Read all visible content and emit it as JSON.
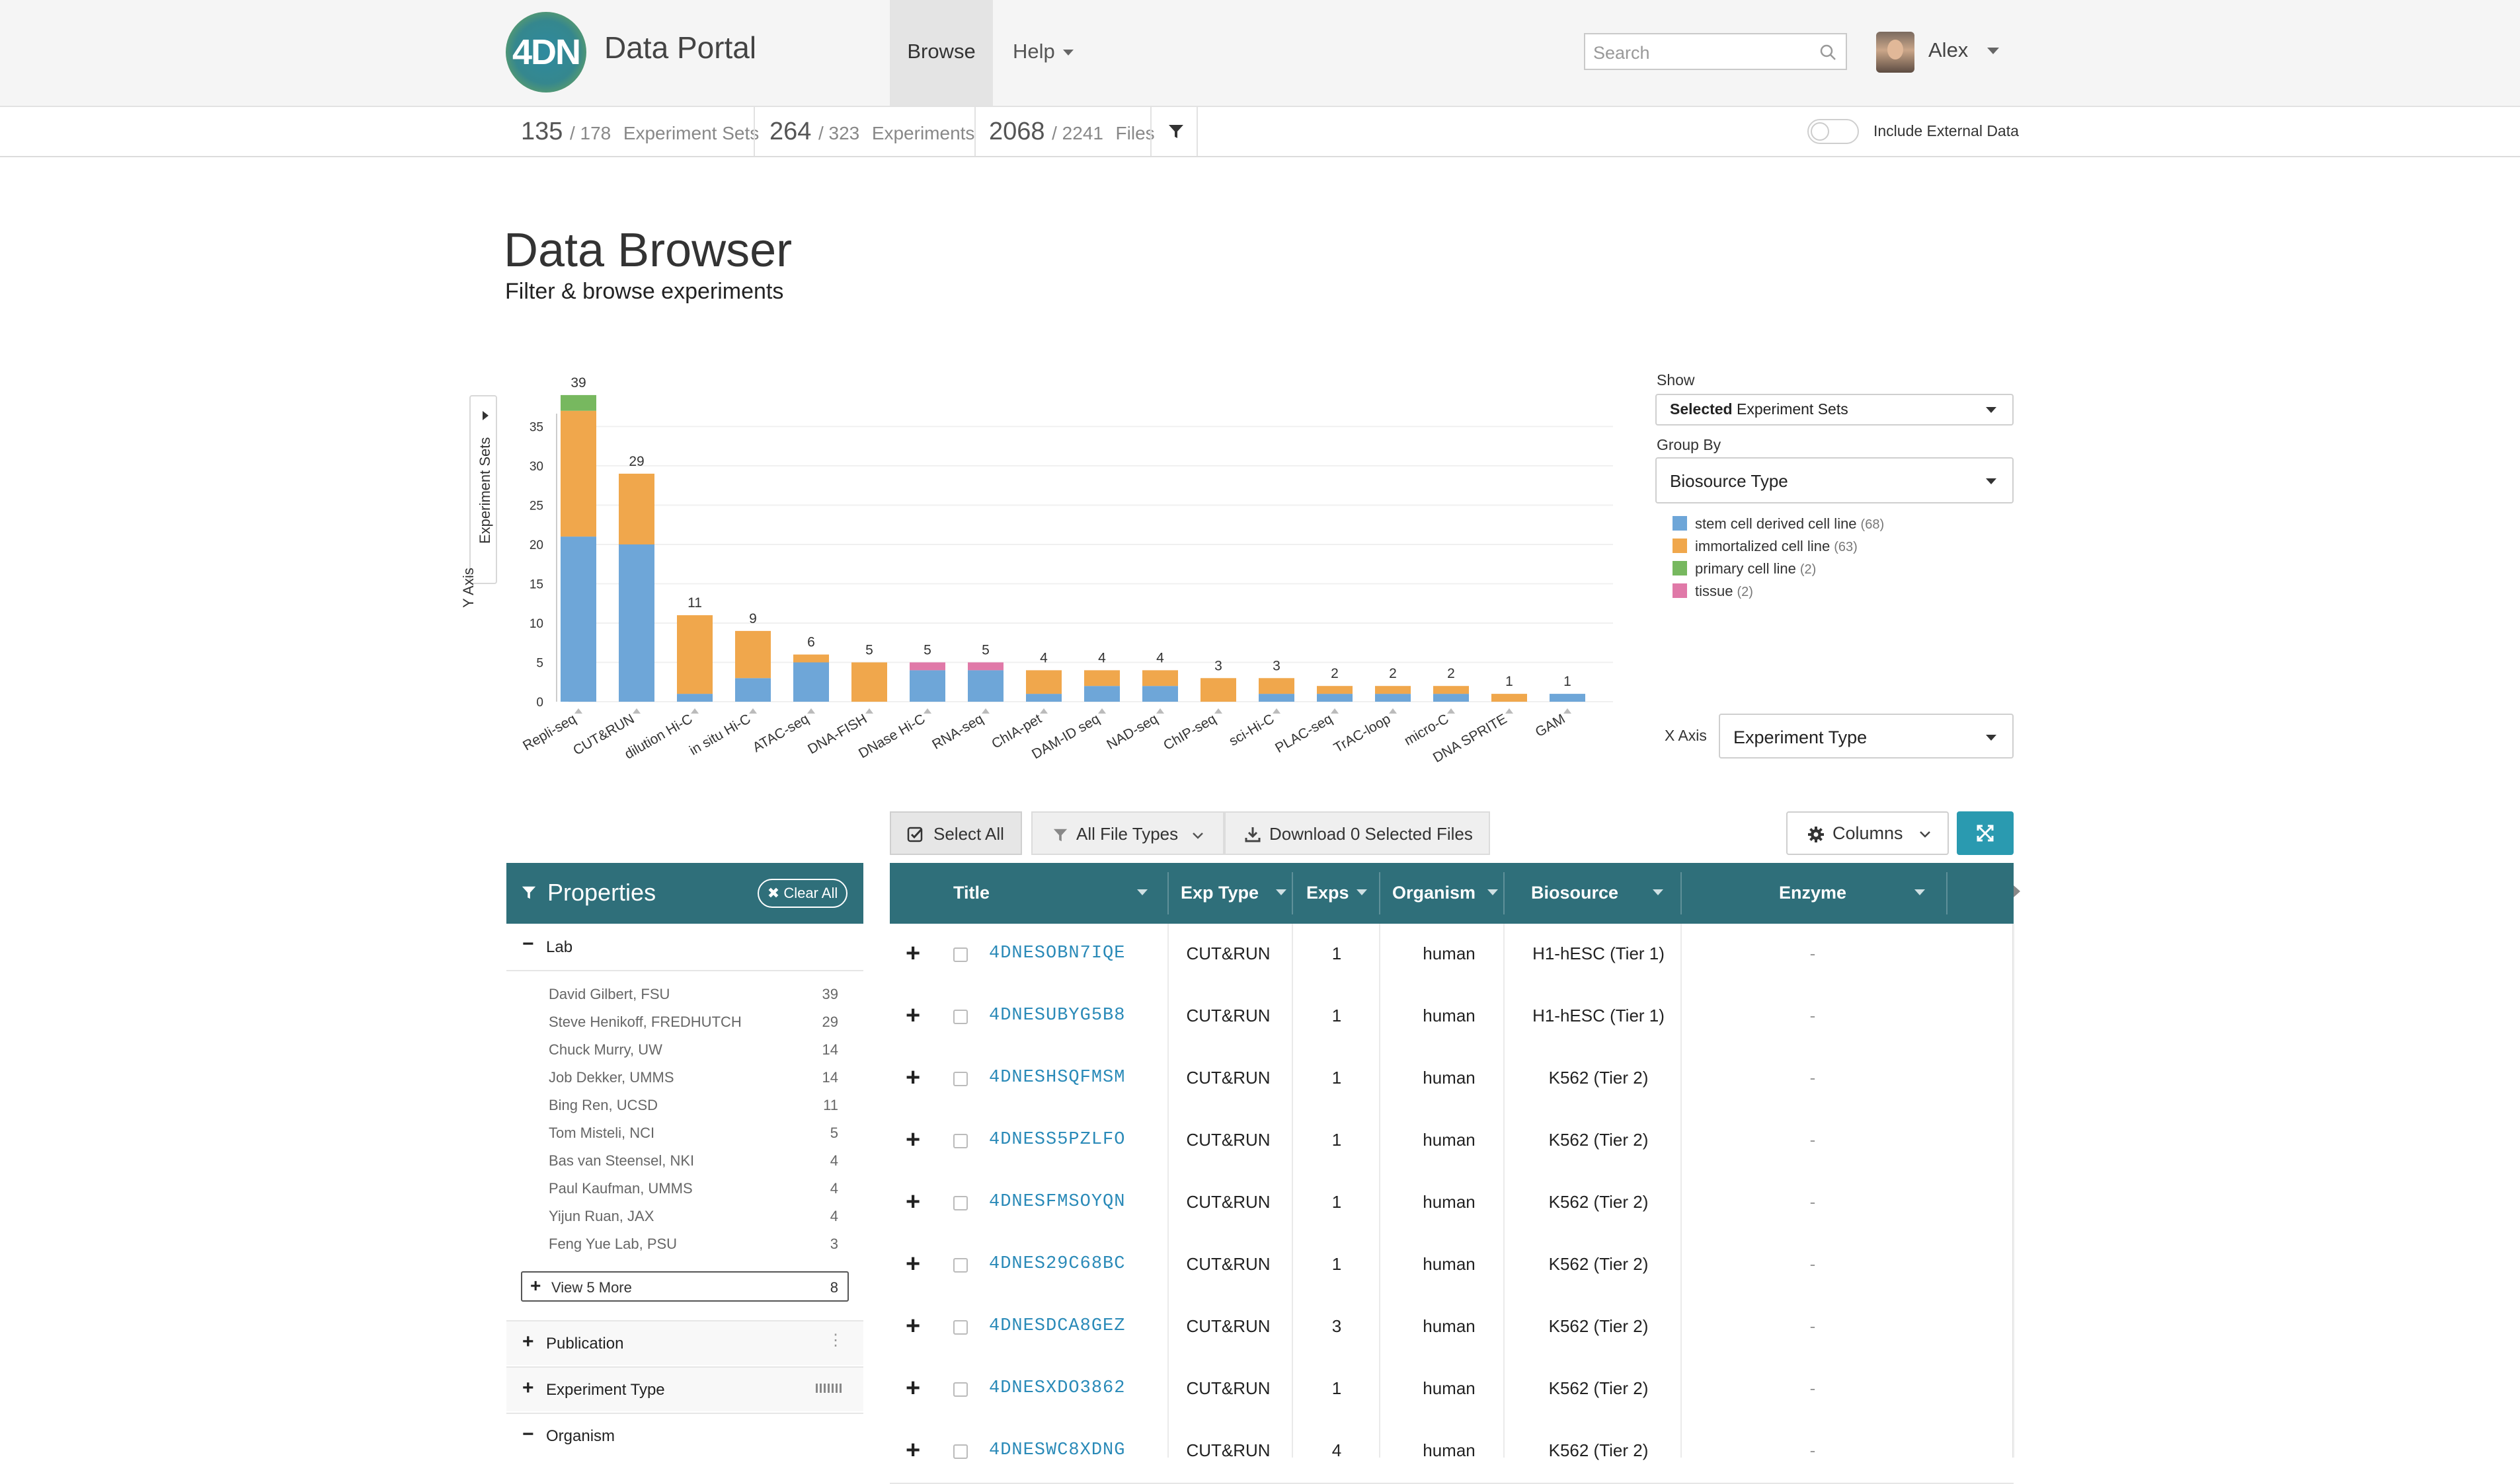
{
  "nav": {
    "logo": "4DN",
    "brand": "Data Portal",
    "browse": "Browse",
    "help": "Help",
    "search_placeholder": "Search",
    "user_name": "Alex"
  },
  "stats": {
    "exp_sets": "135",
    "exp_sets_total": "/ 178",
    "exp_sets_label": "Experiment Sets",
    "experiments": "264",
    "experiments_total": "/ 323",
    "experiments_label": "Experiments",
    "files": "2068",
    "files_total": "/ 2241",
    "files_label": "Files",
    "include_external": "Include External Data"
  },
  "header": {
    "title": "Data Browser",
    "subtitle": "Filter & browse experiments"
  },
  "chart_controls": {
    "y_axis_title": "Experiment Sets",
    "y_axis_label": "Y Axis",
    "show_label": "Show",
    "show_value_bold": "Selected",
    "show_value_rest": " Experiment Sets",
    "group_by_label": "Group By",
    "group_by_value": "Biosource Type",
    "x_axis_label": "X Axis",
    "x_axis_value": "Experiment Type"
  },
  "chart_data": {
    "type": "bar",
    "stacked": true,
    "ylim": [
      0,
      40
    ],
    "yticks": [
      0,
      5,
      10,
      15,
      20,
      25,
      30,
      35
    ],
    "categories": [
      "Repli-seq",
      "CUT&RUN",
      "dilution Hi-C",
      "in situ Hi-C",
      "ATAC-seq",
      "DNA-FISH",
      "DNase Hi-C",
      "RNA-seq",
      "ChIA-pet",
      "DAM-ID seq",
      "NAD-seq",
      "ChIP-seq",
      "sci-Hi-C",
      "PLAC-seq",
      "TrAC-loop",
      "micro-C",
      "DNA SPRITE",
      "GAM"
    ],
    "totals": [
      39,
      29,
      11,
      9,
      6,
      5,
      5,
      5,
      4,
      4,
      4,
      3,
      3,
      2,
      2,
      2,
      1,
      1
    ],
    "series": [
      {
        "name": "stem cell derived cell line",
        "count": "(68)",
        "color": "#6ea6d8",
        "values": [
          21,
          20,
          1,
          3,
          5,
          0,
          4,
          4,
          1,
          2,
          2,
          0,
          1,
          1,
          1,
          1,
          0,
          1
        ]
      },
      {
        "name": "immortalized cell line",
        "count": "(63)",
        "color": "#f0a74c",
        "values": [
          16,
          9,
          10,
          6,
          1,
          5,
          0,
          0,
          3,
          2,
          2,
          3,
          2,
          1,
          1,
          1,
          1,
          0
        ]
      },
      {
        "name": "primary cell line",
        "count": "(2)",
        "color": "#77b85f",
        "values": [
          2,
          0,
          0,
          0,
          0,
          0,
          0,
          0,
          0,
          0,
          0,
          0,
          0,
          0,
          0,
          0,
          0,
          0
        ]
      },
      {
        "name": "tissue",
        "count": "(2)",
        "color": "#e079a8",
        "values": [
          0,
          0,
          0,
          0,
          0,
          0,
          1,
          1,
          0,
          0,
          0,
          0,
          0,
          0,
          0,
          0,
          0,
          0
        ]
      }
    ]
  },
  "toolbar": {
    "select_all": "Select All",
    "file_types": "All File Types",
    "download": "Download 0 Selected Files",
    "columns": "Columns"
  },
  "properties": {
    "title": "Properties",
    "clear_all": "Clear All",
    "lab_title": "Lab",
    "labs": [
      {
        "name": "David Gilbert, FSU",
        "count": "39"
      },
      {
        "name": "Steve Henikoff, FREDHUTCH",
        "count": "29"
      },
      {
        "name": "Chuck Murry, UW",
        "count": "14"
      },
      {
        "name": "Job Dekker, UMMS",
        "count": "14"
      },
      {
        "name": "Bing Ren, UCSD",
        "count": "11"
      },
      {
        "name": "Tom Misteli, NCI",
        "count": "5"
      },
      {
        "name": "Bas van Steensel, NKI",
        "count": "4"
      },
      {
        "name": "Paul Kaufman, UMMS",
        "count": "4"
      },
      {
        "name": "Yijun Ruan, JAX",
        "count": "4"
      },
      {
        "name": "Feng Yue Lab, PSU",
        "count": "3"
      }
    ],
    "view_more": "View 5 More",
    "view_more_count": "8",
    "publication": "Publication",
    "experiment_type": "Experiment Type",
    "organism": "Organism"
  },
  "table": {
    "headers": [
      "Title",
      "Exp Type",
      "Exps",
      "Organism",
      "Biosource",
      "Enzyme"
    ],
    "rows": [
      {
        "title": "4DNESOBN7IQE",
        "exp_type": "CUT&RUN",
        "exps": "1",
        "organism": "human",
        "biosource": "H1-hESC (Tier 1)",
        "enzyme": "-"
      },
      {
        "title": "4DNESUBYG5B8",
        "exp_type": "CUT&RUN",
        "exps": "1",
        "organism": "human",
        "biosource": "H1-hESC (Tier 1)",
        "enzyme": "-"
      },
      {
        "title": "4DNESHSQFMSM",
        "exp_type": "CUT&RUN",
        "exps": "1",
        "organism": "human",
        "biosource": "K562 (Tier 2)",
        "enzyme": "-"
      },
      {
        "title": "4DNESS5PZLFO",
        "exp_type": "CUT&RUN",
        "exps": "1",
        "organism": "human",
        "biosource": "K562 (Tier 2)",
        "enzyme": "-"
      },
      {
        "title": "4DNESFMSOYQN",
        "exp_type": "CUT&RUN",
        "exps": "1",
        "organism": "human",
        "biosource": "K562 (Tier 2)",
        "enzyme": "-"
      },
      {
        "title": "4DNES29C68BC",
        "exp_type": "CUT&RUN",
        "exps": "1",
        "organism": "human",
        "biosource": "K562 (Tier 2)",
        "enzyme": "-"
      },
      {
        "title": "4DNESDCA8GEZ",
        "exp_type": "CUT&RUN",
        "exps": "3",
        "organism": "human",
        "biosource": "K562 (Tier 2)",
        "enzyme": "-"
      },
      {
        "title": "4DNESXDO3862",
        "exp_type": "CUT&RUN",
        "exps": "1",
        "organism": "human",
        "biosource": "K562 (Tier 2)",
        "enzyme": "-"
      },
      {
        "title": "4DNESWC8XDNG",
        "exp_type": "CUT&RUN",
        "exps": "4",
        "organism": "human",
        "biosource": "K562 (Tier 2)",
        "enzyme": "-"
      }
    ]
  }
}
